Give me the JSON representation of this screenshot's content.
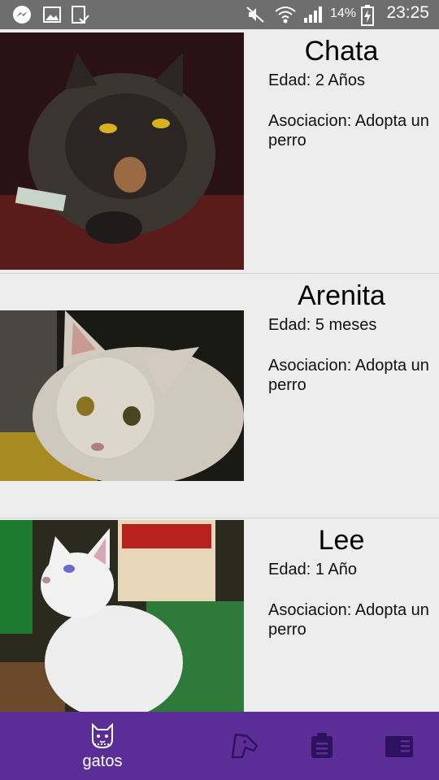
{
  "status_bar": {
    "time": "23:25",
    "battery_percent": "14%",
    "icons": [
      "messenger-icon",
      "gallery-icon",
      "clipboard-check-icon",
      "mute-icon",
      "wifi-icon",
      "signal-icon",
      "battery-charging-icon"
    ]
  },
  "cats": [
    {
      "name": "Chata",
      "age": "Edad: 2 Años",
      "association": "Asociacion: Adopta un perro"
    },
    {
      "name": "Arenita",
      "age": "Edad: 5 meses",
      "association": "Asociacion: Adopta un perro"
    },
    {
      "name": "Lee",
      "age": "Edad: 1 Año",
      "association": "Asociacion: Adopta un perro"
    }
  ],
  "bottom_nav": {
    "items": [
      {
        "icon": "cat-icon",
        "label": "gatos",
        "active": true
      },
      {
        "icon": "dog-icon",
        "label": "",
        "active": false
      },
      {
        "icon": "clipboard-icon",
        "label": "",
        "active": false
      },
      {
        "icon": "news-icon",
        "label": "",
        "active": false
      }
    ],
    "background": "#5b2d96"
  }
}
